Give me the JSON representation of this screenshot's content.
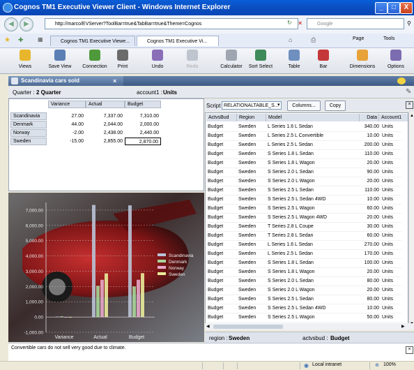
{
  "window": {
    "title": "Cognos TM1 Executive Viewer Client - Windows Internet Explorer",
    "minimize": "_",
    "maximize": "□",
    "close": "X"
  },
  "browser": {
    "url": "http://marco/EVServer?ToolBar=true&TabBar=true&Theme=Cognos",
    "search_placeholder": "Google",
    "tabs": [
      {
        "label": "Cognos TM1 Executive Viewe..."
      },
      {
        "label": "Cognos TM1 Executive Vi..."
      }
    ],
    "commands": {
      "page": "Page",
      "tools": "Tools"
    }
  },
  "toolbar": {
    "items": [
      {
        "label": "Views",
        "icon": "folder-icon",
        "color": "#E8B62C"
      },
      {
        "label": "Save View",
        "icon": "save-icon",
        "color": "#5A7FB5"
      },
      {
        "label": "Connection",
        "icon": "connection-icon",
        "color": "#4E9A3A"
      },
      {
        "label": "Print",
        "icon": "print-icon",
        "color": "#6B6B6B"
      },
      {
        "label": "Undo",
        "icon": "undo-icon",
        "color": "#8A6FB8"
      },
      {
        "label": "Redo",
        "icon": "redo-icon",
        "color": "#BFC5CF"
      },
      {
        "label": "Calculator",
        "icon": "calculator-icon",
        "color": "#9FA6B2"
      },
      {
        "label": "Sort Select",
        "icon": "sort-icon",
        "color": "#3E8A5A"
      },
      {
        "label": "Table",
        "icon": "table-icon",
        "color": "#6F8FBF"
      },
      {
        "label": "Bar",
        "icon": "bar-chart-icon",
        "color": "#C4383A"
      },
      {
        "label": "Dimensions",
        "icon": "dimensions-icon",
        "color": "#E8A23A"
      },
      {
        "label": "Options",
        "icon": "options-icon",
        "color": "#7C6CB0"
      }
    ]
  },
  "panel": {
    "title": "Scandinavia cars sold"
  },
  "filters": {
    "quarter_label": "Quarter :",
    "quarter_value": "2 Quarter",
    "account_label": "account1 :",
    "account_value": "Units"
  },
  "crosstab": {
    "columns": [
      "Variance",
      "Actual",
      "Budget"
    ],
    "rows": [
      {
        "label": "Scandinavia",
        "values": [
          "27.00",
          "7,337.00",
          "7,310.00"
        ]
      },
      {
        "label": "Denmark",
        "values": [
          "44.00",
          "2,044.00",
          "2,000.00"
        ]
      },
      {
        "label": "Norway",
        "values": [
          "-2.00",
          "2,438.00",
          "2,440.00"
        ]
      },
      {
        "label": "Sweden",
        "values": [
          "-15.00",
          "2,855.00",
          "2,870.00"
        ]
      }
    ]
  },
  "chart_data": {
    "type": "bar",
    "categories": [
      "Variance",
      "Actual",
      "Budget"
    ],
    "series": [
      {
        "name": "Scandinavia",
        "values": [
          27,
          7337,
          7310
        ],
        "color": "#B9C3D6"
      },
      {
        "name": "Denmark",
        "values": [
          44,
          2044,
          2000
        ],
        "color": "#A8D59A"
      },
      {
        "name": "Norway",
        "values": [
          -2,
          2438,
          2440
        ],
        "color": "#E8A8C8"
      },
      {
        "name": "Sweden",
        "values": [
          -15,
          2855,
          2870
        ],
        "color": "#E9EC9A"
      }
    ],
    "yticks": [
      "-1,000.00",
      "0.00",
      "1,000.00",
      "2,000.00",
      "3,000.00",
      "4,000.00",
      "5,000.00",
      "6,000.00",
      "7,000.00"
    ],
    "ylim": [
      -1000,
      7500
    ],
    "legend_position": "right"
  },
  "script_bar": {
    "label": "Script",
    "select_value": "RELATIONALTABLE_S...",
    "columns_button": "Columns...",
    "copy_button": "Copy"
  },
  "relational_table": {
    "headers": [
      "ActvsBud",
      "Region",
      "Model",
      "Data",
      "Account1"
    ],
    "rows": [
      [
        "Budget",
        "Sweden",
        "L Series 1.6 L Sedan",
        "340.00",
        "Units"
      ],
      [
        "Budget",
        "Sweden",
        "L Series 2.5 L Convertible",
        "10.00",
        "Units"
      ],
      [
        "Budget",
        "Sweden",
        "L Series 2.5 L Sedan",
        "200.00",
        "Units"
      ],
      [
        "Budget",
        "Sweden",
        "S Series 1.8 L Sedan",
        "110.00",
        "Units"
      ],
      [
        "Budget",
        "Sweden",
        "S Series 1.8 L Wagon",
        "20.00",
        "Units"
      ],
      [
        "Budget",
        "Sweden",
        "S Series 2.0 L Sedan",
        "90.00",
        "Units"
      ],
      [
        "Budget",
        "Sweden",
        "S Series 2.0 L Wagon",
        "20.00",
        "Units"
      ],
      [
        "Budget",
        "Sweden",
        "S Series 2.5 L Sedan",
        "110.00",
        "Units"
      ],
      [
        "Budget",
        "Sweden",
        "S Series 2.5 L Sedan 4WD",
        "10.00",
        "Units"
      ],
      [
        "Budget",
        "Sweden",
        "S Series 2.5 L Wagon",
        "60.00",
        "Units"
      ],
      [
        "Budget",
        "Sweden",
        "S Series 2.5 L Wagon 4WD",
        "20.00",
        "Units"
      ],
      [
        "Budget",
        "Sweden",
        "T Series 2.8 L Coupe",
        "30.00",
        "Units"
      ],
      [
        "Budget",
        "Sweden",
        "T Series 2.8 L Sedan",
        "60.00",
        "Units"
      ],
      [
        "Budget",
        "Sweden",
        "L Series 1.6 L Sedan",
        "270.00",
        "Units"
      ],
      [
        "Budget",
        "Sweden",
        "L Series 2.5 L Sedan",
        "170.00",
        "Units"
      ],
      [
        "Budget",
        "Sweden",
        "S Series 1.8 L Sedan",
        "100.00",
        "Units"
      ],
      [
        "Budget",
        "Sweden",
        "S Series 1.8 L Wagon",
        "20.00",
        "Units"
      ],
      [
        "Budget",
        "Sweden",
        "S Series 2.0 L Sedan",
        "80.00",
        "Units"
      ],
      [
        "Budget",
        "Sweden",
        "S Series 2.0 L Wagon",
        "20.00",
        "Units"
      ],
      [
        "Budget",
        "Sweden",
        "S Series 2.5 L Sedan",
        "80.00",
        "Units"
      ],
      [
        "Budget",
        "Sweden",
        "S Series 2.5 L Sedan 4WD",
        "10.00",
        "Units"
      ],
      [
        "Budget",
        "Sweden",
        "S Series 2.5 L Wagon",
        "50.00",
        "Units"
      ]
    ]
  },
  "bottom_filters": {
    "region_label": "region :",
    "region_value": "Sweden",
    "actvsbud_label": "actvsbud :",
    "actvsbud_value": "Budget"
  },
  "notes": {
    "text": "Convertible cars do not sell very good due to climate."
  },
  "statusbar": {
    "zone": "Local intranet",
    "zoom": "100%"
  }
}
